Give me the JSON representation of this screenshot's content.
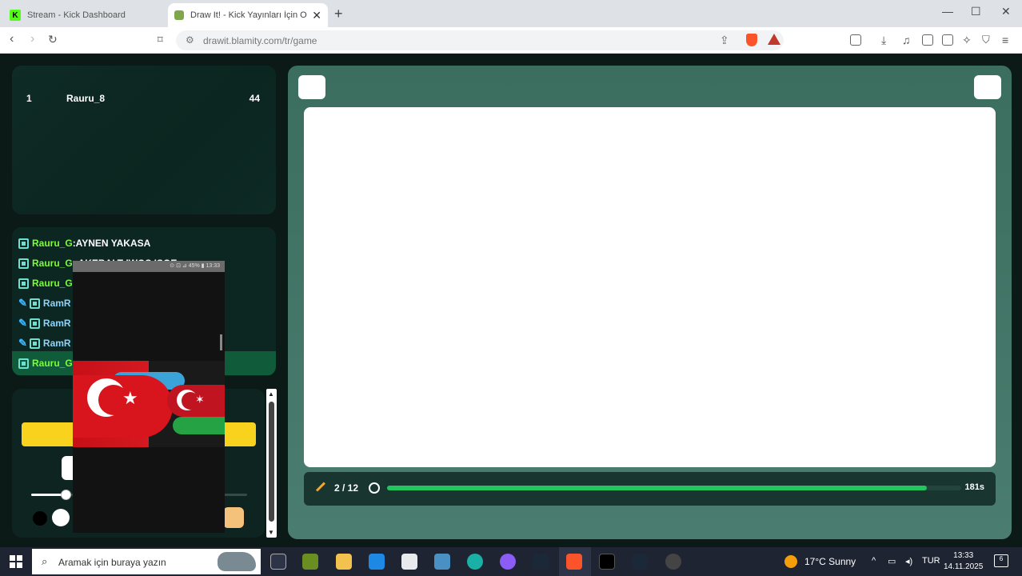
{
  "browser": {
    "tabs": [
      {
        "title": "Stream - Kick Dashboard",
        "icon": "kick-icon"
      },
      {
        "title": "Draw It! - Kick Yayınları İçin O",
        "icon": "drawit-icon"
      }
    ],
    "new_tab": "+",
    "url": "drawit.blamity.com/tr/game",
    "window_controls": {
      "minimize": "—",
      "maximize": "☐",
      "close": "✕"
    },
    "favicon_letter": "K"
  },
  "leaderboard": {
    "rows": [
      {
        "rank": "1",
        "name": "Rauru_8",
        "score": "44"
      }
    ]
  },
  "chat": {
    "lines": [
      {
        "user": "Rauru_G",
        "msg": ":AYNEN YAKASA",
        "color": "green",
        "drawer": false
      },
      {
        "user": "Rauru_G",
        "msg": ": AKEBALT IWOS ISOE",
        "color": "green",
        "drawer": false
      },
      {
        "user": "Rauru_G",
        "msg": "",
        "color": "green",
        "drawer": false
      },
      {
        "user": "RamR",
        "msg": "",
        "color": "blue",
        "drawer": true
      },
      {
        "user": "RamR",
        "msg": "",
        "color": "blue",
        "drawer": true
      },
      {
        "user": "RamR",
        "msg": "",
        "color": "blue",
        "drawer": true
      },
      {
        "user": "Rauru_G",
        "msg": "",
        "color": "green",
        "drawer": false,
        "highlight": true
      }
    ]
  },
  "controls": {
    "brush_size_fraction": 0.16,
    "accent_yellow": "#f8d21c"
  },
  "phone_overlay": {
    "status": "⊙ ⊡ ⊿ 45% ▮ 13:33"
  },
  "game": {
    "round": "2 / 12",
    "time_left": "181s",
    "progress_fraction": 0.94,
    "progress_color": "#22c55e"
  },
  "taskbar": {
    "search_placeholder": "Aramak için buraya yazın",
    "weather": "17°C  Sunny",
    "language": "TUR",
    "time": "13:33",
    "date": "14.11.2025",
    "notifications": "6",
    "tray_arrow": "^"
  }
}
